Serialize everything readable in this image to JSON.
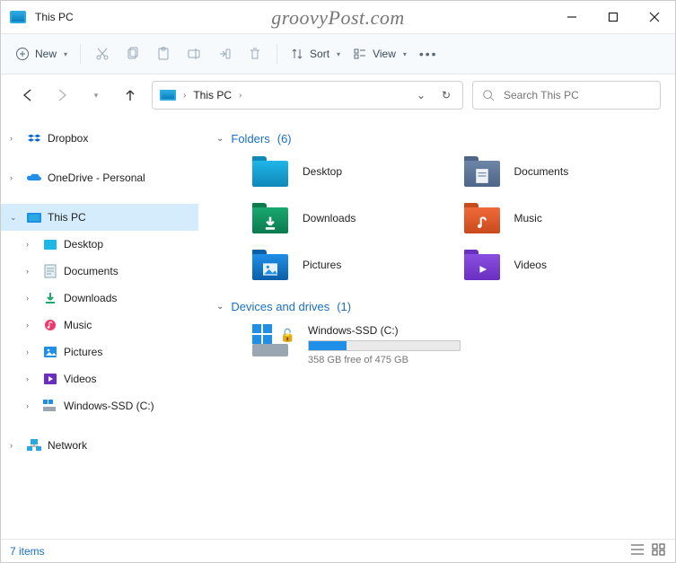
{
  "window": {
    "title": "This PC",
    "watermark": "groovyPost.com"
  },
  "toolbar": {
    "new_label": "New",
    "sort_label": "Sort",
    "view_label": "View"
  },
  "breadcrumb": {
    "root": "This PC"
  },
  "search": {
    "placeholder": "Search This PC"
  },
  "sidebar": {
    "dropbox": "Dropbox",
    "onedrive": "OneDrive - Personal",
    "thispc": "This PC",
    "desktop": "Desktop",
    "documents": "Documents",
    "downloads": "Downloads",
    "music": "Music",
    "pictures": "Pictures",
    "videos": "Videos",
    "drive": "Windows-SSD (C:)",
    "network": "Network"
  },
  "groups": {
    "folders": {
      "label": "Folders",
      "count": "(6)"
    },
    "drives": {
      "label": "Devices and drives",
      "count": "(1)"
    }
  },
  "folders": {
    "desktop": {
      "label": "Desktop",
      "color": "#1fb6e8",
      "tab": "#0f88b8"
    },
    "documents": {
      "label": "Documents",
      "color": "#6d86a8",
      "tab": "#4d6688"
    },
    "downloads": {
      "label": "Downloads",
      "color": "#1aa86f",
      "tab": "#0a7a4f"
    },
    "music": {
      "label": "Music",
      "color": "#ef6a3b",
      "tab": "#c94a1b"
    },
    "pictures": {
      "label": "Pictures",
      "color": "#1f8fe8",
      "tab": "#0a5fa8"
    },
    "videos": {
      "label": "Videos",
      "color": "#8a4fe0",
      "tab": "#6a2fc0"
    }
  },
  "drive": {
    "name": "Windows-SSD (C:)",
    "free_text": "358 GB free of 475 GB",
    "used_pct": 25
  },
  "status": {
    "items": "7 items"
  }
}
